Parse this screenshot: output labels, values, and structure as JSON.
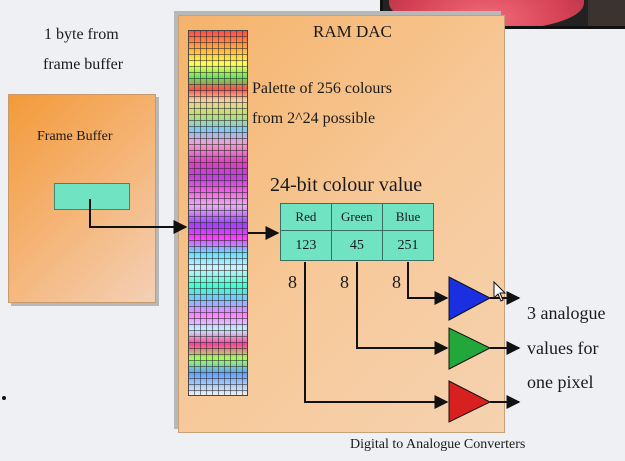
{
  "byte_label": [
    "1 byte from",
    "frame buffer"
  ],
  "frame_buffer_title": "Frame Buffer",
  "ram_dac_title": "RAM DAC",
  "palette_caption": [
    "Palette of 256 colours",
    "from 2^24 possible"
  ],
  "colour_value_title": "24-bit colour value",
  "channels": [
    {
      "name": "Red",
      "value": "123",
      "bits": "8",
      "color": "#d92020"
    },
    {
      "name": "Green",
      "value": "45",
      "bits": "8",
      "color": "#22a83a"
    },
    {
      "name": "Blue",
      "value": "251",
      "bits": "8",
      "color": "#1a2fe0"
    }
  ],
  "output_caption": [
    "3 analogue",
    "values for",
    "one pixel"
  ],
  "dac_caption": "Digital to Analogue Converters",
  "colors": {
    "teal_box": "#6fe3c2",
    "panel_orange": "#f5b36a"
  }
}
